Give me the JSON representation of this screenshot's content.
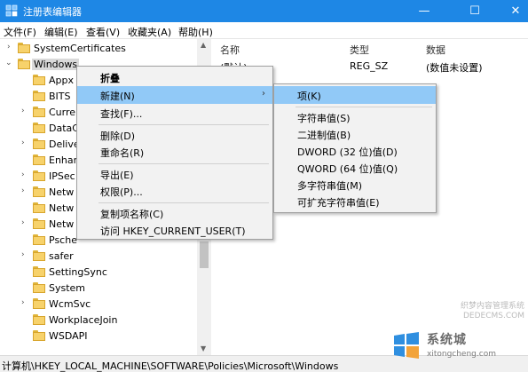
{
  "window": {
    "title": "注册表编辑器",
    "min_glyph": "—",
    "max_glyph": "☐",
    "close_glyph": "✕",
    "titlebar_color": "#1e87e5"
  },
  "menubar": {
    "items": [
      "文件(F)",
      "编辑(E)",
      "查看(V)",
      "收藏夹(A)",
      "帮助(H)"
    ]
  },
  "tree": {
    "items": [
      {
        "label": "SystemCertificates",
        "expanded": false
      },
      {
        "label": "Windows",
        "expanded": true,
        "selected": true
      },
      {
        "label": "Appx",
        "expanded": false
      },
      {
        "label": "BITS",
        "expanded": false
      },
      {
        "label": "Curre",
        "expanded": false
      },
      {
        "label": "DataC",
        "expanded": false
      },
      {
        "label": "Delive",
        "expanded": false
      },
      {
        "label": "Enhar",
        "expanded": false
      },
      {
        "label": "IPSec",
        "expanded": false
      },
      {
        "label": "Netw",
        "expanded": false
      },
      {
        "label": "Netw",
        "expanded": false
      },
      {
        "label": "Netw",
        "expanded": false
      },
      {
        "label": "Psche",
        "expanded": false
      },
      {
        "label": "safer",
        "expanded": false
      },
      {
        "label": "SettingSync",
        "expanded": false
      },
      {
        "label": "System",
        "expanded": false
      },
      {
        "label": "WcmSvc",
        "expanded": false
      },
      {
        "label": "WorkplaceJoin",
        "expanded": false
      },
      {
        "label": "WSDAPI",
        "expanded": false
      }
    ]
  },
  "values": {
    "headers": {
      "name": "名称",
      "type": "类型",
      "data": "数据"
    },
    "rows": [
      {
        "name": "(默认)",
        "type": "REG_SZ",
        "data": "(数值未设置)"
      }
    ]
  },
  "context_menu": {
    "items": [
      {
        "label": "折叠",
        "bold": true
      },
      {
        "label": "新建(N)",
        "submenu": true,
        "highlighted": true
      },
      {
        "label": "查找(F)..."
      },
      {
        "label": "删除(D)"
      },
      {
        "label": "重命名(R)"
      },
      {
        "label": "导出(E)"
      },
      {
        "label": "权限(P)..."
      },
      {
        "label": "复制项名称(C)"
      },
      {
        "label": "访问 HKEY_CURRENT_USER(T)"
      }
    ]
  },
  "submenu": {
    "items": [
      {
        "label": "项(K)",
        "highlighted": true
      },
      {
        "label": "字符串值(S)"
      },
      {
        "label": "二进制值(B)"
      },
      {
        "label": "DWORD (32 位)值(D)"
      },
      {
        "label": "QWORD (64 位)值(Q)"
      },
      {
        "label": "多字符串值(M)"
      },
      {
        "label": "可扩充字符串值(E)"
      }
    ]
  },
  "statusbar": {
    "path": "计算机\\HKEY_LOCAL_MACHINE\\SOFTWARE\\Policies\\Microsoft\\Windows"
  },
  "watermark": {
    "brand": "系统城",
    "url": "xitongcheng.com",
    "cms_line1": "织梦内容管理系统",
    "cms_line2": "DEDECMS.COM"
  },
  "icons": {
    "app": "registry-editor-icon",
    "folder": "folder-icon",
    "expand": "chevron-right-icon",
    "collapse": "chevron-down-icon",
    "submenu": "chevron-right-icon"
  }
}
